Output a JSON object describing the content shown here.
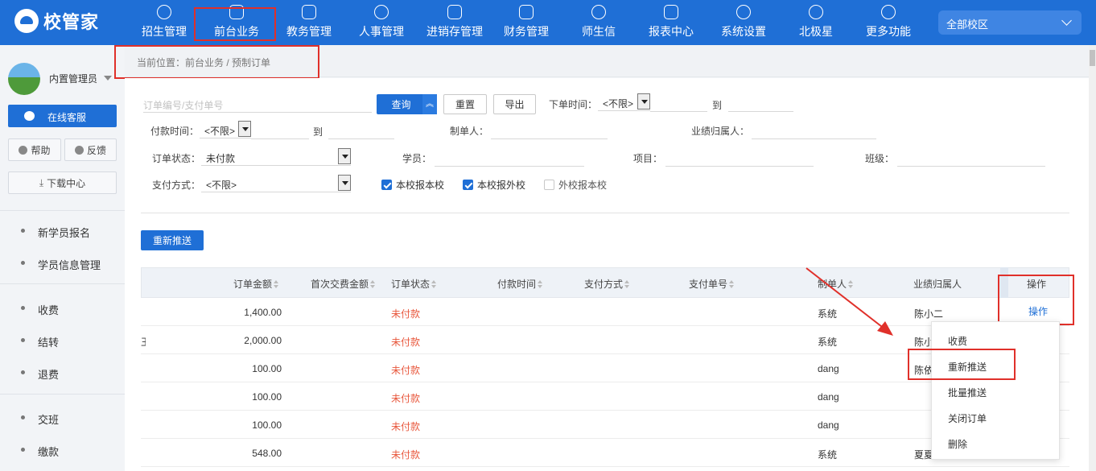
{
  "brand": {
    "logo_text": "校管家"
  },
  "nav": [
    {
      "label": "招生管理",
      "icon": "user-add-icon"
    },
    {
      "label": "前台业务",
      "icon": "window-icon"
    },
    {
      "label": "教务管理",
      "icon": "book-icon"
    },
    {
      "label": "人事管理",
      "icon": "person-icon"
    },
    {
      "label": "进销存管理",
      "icon": "exchange-icon"
    },
    {
      "label": "财务管理",
      "icon": "yen-shield-icon"
    },
    {
      "label": "师生信",
      "icon": "chat-icon"
    },
    {
      "label": "报表中心",
      "icon": "chart-icon"
    },
    {
      "label": "系统设置",
      "icon": "gear-icon"
    },
    {
      "label": "北极星",
      "icon": "star-icon"
    },
    {
      "label": "更多功能",
      "icon": "more-icon"
    }
  ],
  "campus": {
    "selected": "全部校区"
  },
  "sidebar": {
    "user_name": "内置管理员",
    "service_label": "在线客服",
    "help_label": "帮助",
    "feedback_label": "反馈",
    "download_label": "下载中心",
    "items": [
      {
        "label": "新学员报名"
      },
      {
        "label": "学员信息管理"
      },
      {
        "label": "收费"
      },
      {
        "label": "结转"
      },
      {
        "label": "退费"
      },
      {
        "label": "交班"
      },
      {
        "label": "缴款"
      }
    ]
  },
  "breadcrumb": {
    "text": "当前位置：前台业务 / 预制订单"
  },
  "filters": {
    "search_placeholder": "订单编号/支付单号",
    "query_label": "查询",
    "reset_label": "重置",
    "export_label": "导出",
    "order_time_label": "下单时间：",
    "order_time_value": "<不限>",
    "to_label": "到",
    "pay_time_label": "付款时间：",
    "pay_time_value": "<不限>",
    "creator_label": "制单人：",
    "performance_label": "业绩归属人：",
    "order_status_label": "订单状态：",
    "order_status_value": "未付款",
    "student_label": "学员：",
    "project_label": "项目：",
    "class_label": "班级：",
    "pay_method_label": "支付方式：",
    "pay_method_value": "<不限>",
    "checkboxes": [
      {
        "label": "本校报本校",
        "checked": true
      },
      {
        "label": "本校报外校",
        "checked": true
      },
      {
        "label": "外校报本校",
        "checked": false
      }
    ]
  },
  "repush_label": "重新推送",
  "table": {
    "headers": [
      "订单金额",
      "首次交费金额",
      "订单状态",
      "付款时间",
      "支付方式",
      "支付单号",
      "制单人",
      "业绩归属人",
      "操作"
    ],
    "rows": [
      {
        "lead": "",
        "amount": "1,400.00",
        "status": "未付款",
        "creator": "系统",
        "owner": "陈小二",
        "op": "操作"
      },
      {
        "lead": "王",
        "amount": "2,000.00",
        "status": "未付款",
        "creator": "系统",
        "owner": "陈小",
        "op": ""
      },
      {
        "lead": "",
        "amount": "100.00",
        "status": "未付款",
        "creator": "dang",
        "owner": "陈依",
        "op": ""
      },
      {
        "lead": "",
        "amount": "100.00",
        "status": "未付款",
        "creator": "dang",
        "owner": "",
        "op": ""
      },
      {
        "lead": "",
        "amount": "100.00",
        "status": "未付款",
        "creator": "dang",
        "owner": "",
        "op": ""
      },
      {
        "lead": "",
        "amount": "548.00",
        "status": "未付款",
        "creator": "系统",
        "owner": "夏夏",
        "op": ""
      }
    ]
  },
  "op_menu": {
    "items": [
      {
        "label": "收费"
      },
      {
        "label": "重新推送"
      },
      {
        "label": "批量推送"
      },
      {
        "label": "关闭订单"
      },
      {
        "label": "删除"
      }
    ]
  },
  "colors": {
    "primary": "#1f6fd6",
    "danger_text": "#e8573c",
    "highlight_box": "#e0302a"
  }
}
